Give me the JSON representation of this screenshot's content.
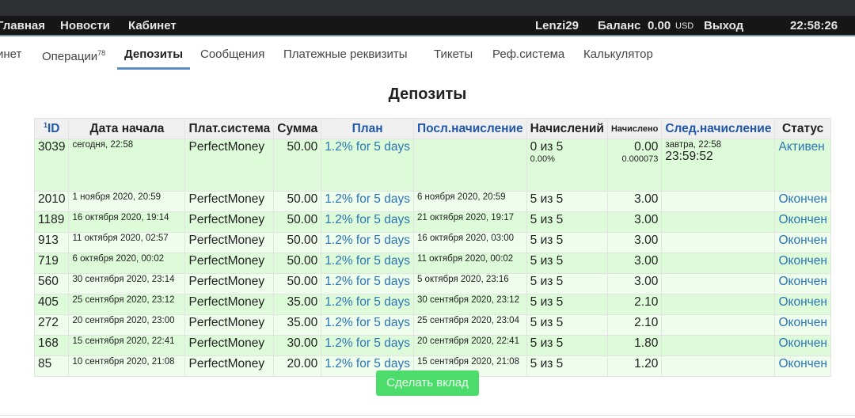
{
  "topnav": {
    "items": [
      "Главная",
      "Новости",
      "Кабинет"
    ],
    "user": "Lenzi29",
    "balance_label": "Баланс",
    "balance_value": "0.00",
    "currency": "USD",
    "logout": "Выход",
    "time": "22:58:26"
  },
  "tabs": [
    {
      "label": "инет"
    },
    {
      "label": "Операции",
      "badge": "78"
    },
    {
      "label": "Депозиты",
      "active": true
    },
    {
      "label": "Сообщения"
    },
    {
      "label": "Платежные реквизиты"
    },
    {
      "label": "Тикеты"
    },
    {
      "label": "Реф.система"
    },
    {
      "label": "Калькулятор"
    }
  ],
  "page_title": "Депозиты",
  "table": {
    "headers": {
      "id_sup": "1",
      "id": "ID",
      "start": "Дата начала",
      "system": "Плат.система",
      "sum": "Сумма",
      "plan": "План",
      "last": "Посл.начисление",
      "count": "Начислений",
      "accrued": "Начислено",
      "next": "След.начисление",
      "status": "Статус"
    },
    "rows": [
      {
        "id": "3039",
        "start": "сегодня, 22:58",
        "system": "PerfectMoney",
        "sum": "50.00",
        "plan": "1.2% for 5 days",
        "last": "",
        "count": "0 из 5",
        "count_sub": "0.00%",
        "accrued": "0.00",
        "accrued_sub": "0.000073",
        "next": "завтра, 22:58",
        "next_timer": "23:59:52",
        "status": "Активен"
      },
      {
        "id": "2010",
        "start": "1 ноября 2020, 20:59",
        "system": "PerfectMoney",
        "sum": "50.00",
        "plan": "1.2% for 5 days",
        "last": "6 ноября 2020, 20:59",
        "count": "5 из 5",
        "accrued": "3.00",
        "status": "Окончен"
      },
      {
        "id": "1189",
        "start": "16 октября 2020, 19:14",
        "system": "PerfectMoney",
        "sum": "50.00",
        "plan": "1.2% for 5 days",
        "last": "21 октября 2020, 19:17",
        "count": "5 из 5",
        "accrued": "3.00",
        "status": "Окончен"
      },
      {
        "id": "913",
        "start": "11 октября 2020, 02:57",
        "system": "PerfectMoney",
        "sum": "50.00",
        "plan": "1.2% for 5 days",
        "last": "16 октября 2020, 03:00",
        "count": "5 из 5",
        "accrued": "3.00",
        "status": "Окончен"
      },
      {
        "id": "719",
        "start": "6 октября 2020, 00:02",
        "system": "PerfectMoney",
        "sum": "50.00",
        "plan": "1.2% for 5 days",
        "last": "11 октября 2020, 00:02",
        "count": "5 из 5",
        "accrued": "3.00",
        "status": "Окончен"
      },
      {
        "id": "560",
        "start": "30 сентября 2020, 23:14",
        "system": "PerfectMoney",
        "sum": "50.00",
        "plan": "1.2% for 5 days",
        "last": "5 октября 2020, 23:16",
        "count": "5 из 5",
        "accrued": "3.00",
        "status": "Окончен"
      },
      {
        "id": "405",
        "start": "25 сентября 2020, 23:12",
        "system": "PerfectMoney",
        "sum": "35.00",
        "plan": "1.2% for 5 days",
        "last": "30 сентября 2020, 23:12",
        "count": "5 из 5",
        "accrued": "2.10",
        "status": "Окончен"
      },
      {
        "id": "272",
        "start": "20 сентября 2020, 23:00",
        "system": "PerfectMoney",
        "sum": "35.00",
        "plan": "1.2% for 5 days",
        "last": "25 сентября 2020, 23:04",
        "count": "5 из 5",
        "accrued": "2.10",
        "status": "Окончен"
      },
      {
        "id": "168",
        "start": "15 сентября 2020, 22:41",
        "system": "PerfectMoney",
        "sum": "30.00",
        "plan": "1.2% for 5 days",
        "last": "20 сентября 2020, 22:41",
        "count": "5 из 5",
        "accrued": "1.80",
        "status": "Окончен"
      },
      {
        "id": "85",
        "start": "10 сентября 2020, 21:08",
        "system": "PerfectMoney",
        "sum": "20.00",
        "plan": "1.2% for 5 days",
        "last": "15 сентября 2020, 21:08",
        "count": "5 из 5",
        "accrued": "1.20",
        "status": "Окончен"
      }
    ]
  },
  "make_deposit": "Сделать вклад"
}
